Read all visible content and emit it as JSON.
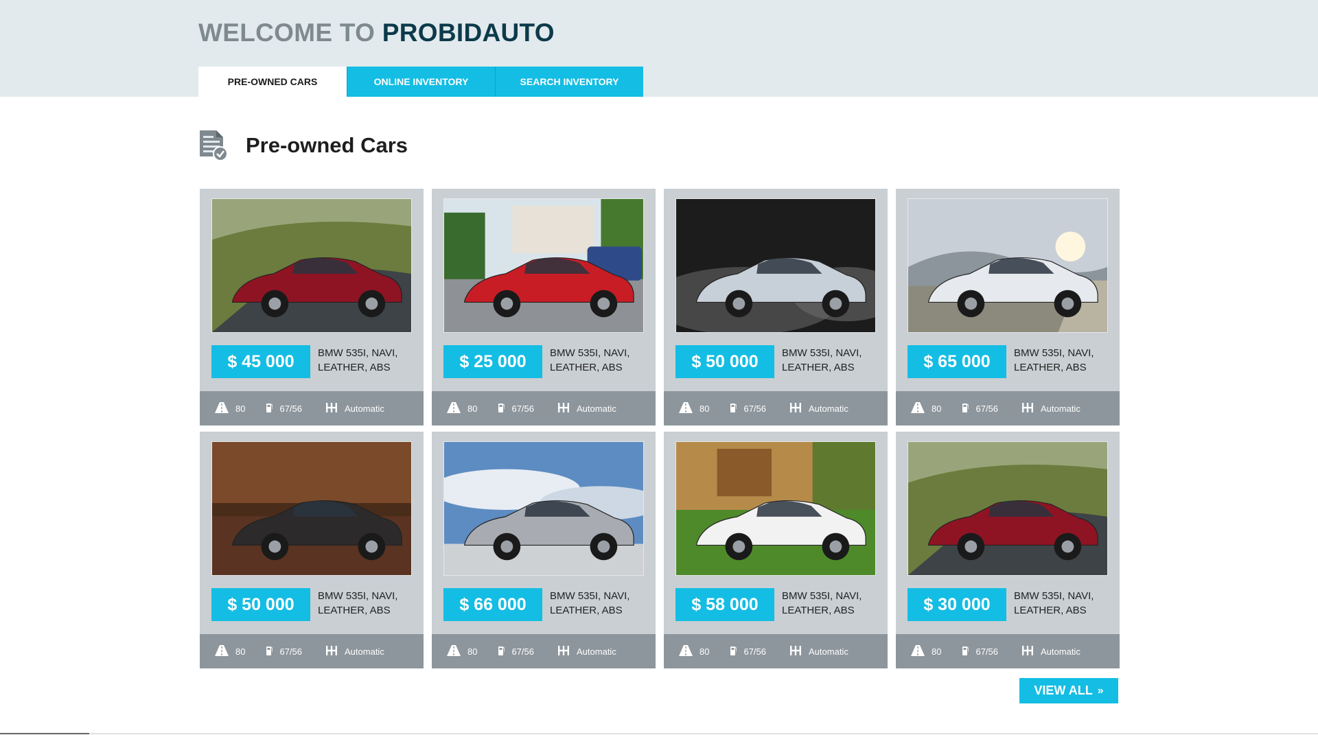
{
  "header": {
    "welcome_prefix": "WELCOME TO",
    "brand": "PROBIDAUTO",
    "tabs": [
      {
        "label": "PRE-OWNED CARS",
        "active": true
      },
      {
        "label": "ONLINE INVENTORY",
        "active": false
      },
      {
        "label": "SEARCH INVENTORY",
        "active": false
      }
    ]
  },
  "section": {
    "title": "Pre-owned Cars",
    "icon": "document-check-icon"
  },
  "cars": [
    {
      "price": "$ 45 000",
      "desc": "BMW 535I, NAVI, LEATHER, ABS",
      "mileage": "80",
      "fuel": "67/56",
      "transmission": "Automatic",
      "image": "red-sedan-road",
      "color": "#8e1424"
    },
    {
      "price": "$ 25 000",
      "desc": "BMW 535I, NAVI, LEATHER, ABS",
      "mileage": "80",
      "fuel": "67/56",
      "transmission": "Automatic",
      "image": "red-suv-street",
      "color": "#c81d25"
    },
    {
      "price": "$ 50 000",
      "desc": "BMW 535I, NAVI, LEATHER, ABS",
      "mileage": "80",
      "fuel": "67/56",
      "transmission": "Automatic",
      "image": "silver-convertible-smoke",
      "color": "#c7cfd8"
    },
    {
      "price": "$ 65 000",
      "desc": "BMW 535I, NAVI, LEATHER, ABS",
      "mileage": "80",
      "fuel": "67/56",
      "transmission": "Automatic",
      "image": "white-sedan-sunset",
      "color": "#e6e9ee"
    },
    {
      "price": "$ 50 000",
      "desc": "BMW 535I, NAVI, LEATHER, ABS",
      "mileage": "80",
      "fuel": "67/56",
      "transmission": "Automatic",
      "image": "dark-sedan-dusk",
      "color": "#2c2a2a"
    },
    {
      "price": "$ 66 000",
      "desc": "BMW 535I, NAVI, LEATHER, ABS",
      "mileage": "80",
      "fuel": "67/56",
      "transmission": "Automatic",
      "image": "silver-coupe-sky",
      "color": "#a8acb2"
    },
    {
      "price": "$ 58 000",
      "desc": "BMW 535I, NAVI, LEATHER, ABS",
      "mileage": "80",
      "fuel": "67/56",
      "transmission": "Automatic",
      "image": "white-sportscar-lawn",
      "color": "#f2f2f2"
    },
    {
      "price": "$ 30 000",
      "desc": "BMW 535I, NAVI, LEATHER, ABS",
      "mileage": "80",
      "fuel": "67/56",
      "transmission": "Automatic",
      "image": "red-sedan-road",
      "color": "#8e1424"
    }
  ],
  "view_all": {
    "label": "VIEW ALL",
    "icon": "double-chevron-right-icon"
  },
  "colors": {
    "accent": "#14bde3",
    "header_bg": "#e2eaed",
    "card_bg": "#c9cfd3",
    "spec_bar": "#8d969d",
    "brand": "#0c3a4a"
  }
}
